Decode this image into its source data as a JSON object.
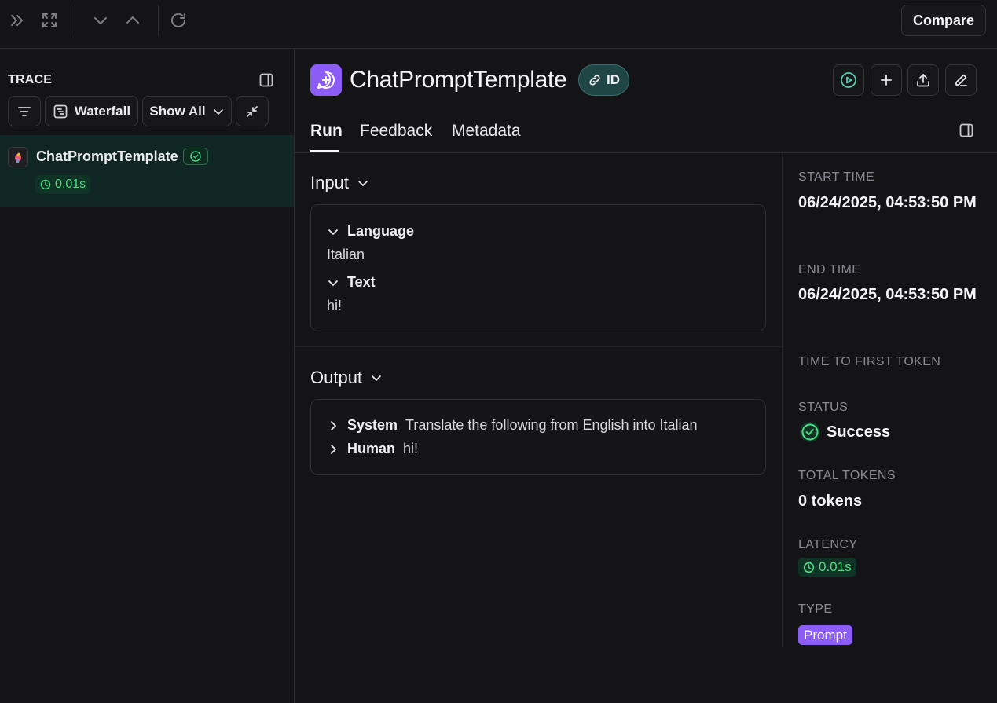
{
  "toolbar": {
    "icons": [
      "double-chevron-right-icon",
      "expand-icon",
      "chevron-down-icon",
      "chevron-up-icon",
      "refresh-icon"
    ],
    "compare_label": "Compare"
  },
  "sidebar": {
    "title": "TRACE",
    "waterfall_label": "Waterfall",
    "show_all_label": "Show All",
    "tree": [
      {
        "name": "ChatPromptTemplate",
        "latency": "0.01s",
        "status": "success"
      }
    ]
  },
  "run": {
    "name": "ChatPromptTemplate",
    "id_label": "ID",
    "tabs": [
      "Run",
      "Feedback",
      "Metadata"
    ],
    "active_tab": "Run"
  },
  "input": {
    "title": "Input",
    "fields": [
      {
        "key": "Language",
        "value": "Italian"
      },
      {
        "key": "Text",
        "value": "hi!"
      }
    ]
  },
  "output": {
    "title": "Output",
    "messages": [
      {
        "role": "System",
        "text": "Translate the following from English into Italian"
      },
      {
        "role": "Human",
        "text": "hi!"
      }
    ]
  },
  "meta": {
    "start_time_label": "START TIME",
    "start_time": "06/24/2025, 04:53:50 PM",
    "end_time_label": "END TIME",
    "end_time": "06/24/2025, 04:53:50 PM",
    "ttft_label": "TIME TO FIRST TOKEN",
    "status_label": "STATUS",
    "status": "Success",
    "total_tokens_label": "TOTAL TOKENS",
    "total_tokens": "0 tokens",
    "latency_label": "LATENCY",
    "latency": "0.01s",
    "type_label": "TYPE",
    "type": "Prompt"
  },
  "colors": {
    "background": "#141416",
    "accent_purple": "#8b5cf6",
    "success_green": "#4ade80",
    "selected_row": "#0f2624"
  }
}
